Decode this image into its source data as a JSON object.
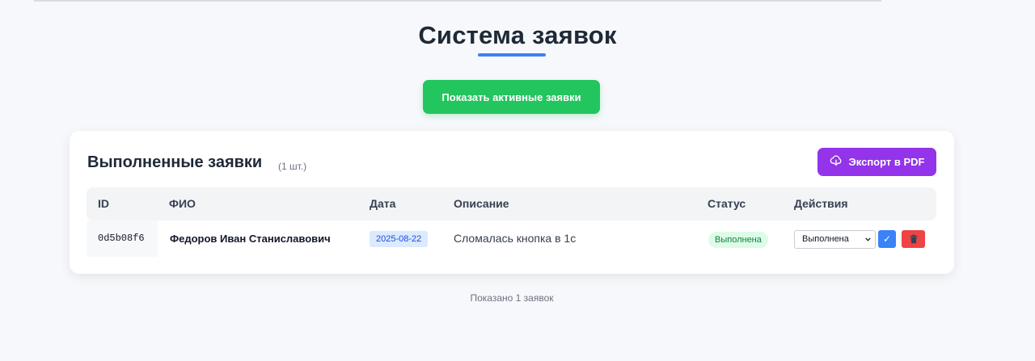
{
  "header": {
    "title": "Система заявок",
    "toggle_button": "Показать активные заявки"
  },
  "card": {
    "title": "Выполненные заявки",
    "count": "(1 шт.)",
    "export_button": "Экспорт в PDF",
    "export_icon": "cloud-download-icon"
  },
  "table": {
    "columns": [
      "ID",
      "ФИО",
      "Дата",
      "Описание",
      "Статус",
      "Действия"
    ],
    "rows": [
      {
        "id": "0d5b08f6",
        "name": "Федоров Иван Станиславович",
        "date": "2025-08-22",
        "description": "Сломалась кнопка в 1с",
        "status": "Выполнена",
        "status_select": "Выполнена",
        "confirm_icon": "✓",
        "delete_icon": "trash-icon"
      }
    ]
  },
  "footer": {
    "shown_text": "Показано 1 заявок"
  },
  "colors": {
    "accent_blue": "#3b82f6",
    "green": "#22c55e",
    "purple": "#9333ea",
    "red": "#ef4444"
  }
}
